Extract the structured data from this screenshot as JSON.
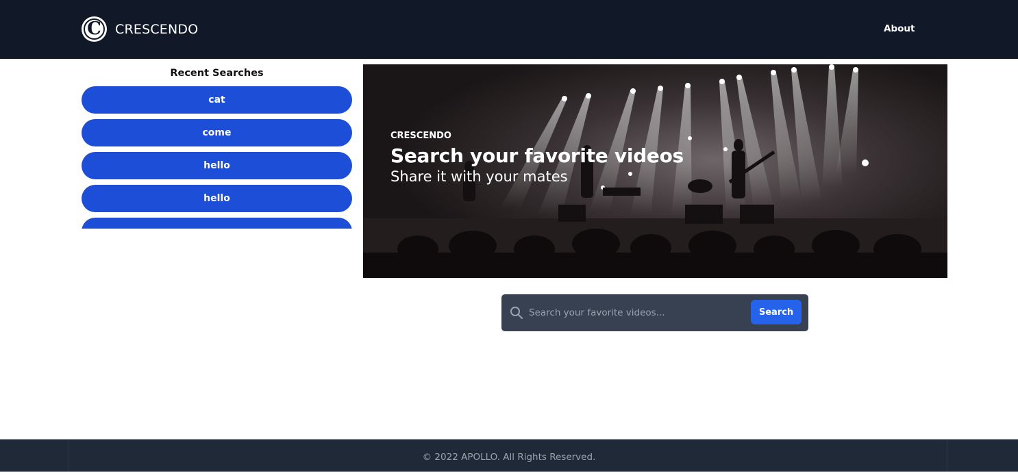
{
  "header": {
    "logo_letter": "C",
    "brand": "CRESCENDO",
    "nav": {
      "about": "About"
    }
  },
  "sidebar": {
    "title": "Recent Searches",
    "items": [
      {
        "label": "cat"
      },
      {
        "label": "come"
      },
      {
        "label": "hello"
      },
      {
        "label": "hello"
      },
      {
        "label": ""
      }
    ]
  },
  "hero": {
    "eyebrow": "CRESCENDO",
    "title": "Search your favorite videos",
    "subtitle": "Share it with your mates"
  },
  "search": {
    "placeholder": "Search your favorite videos...",
    "value": "",
    "button_label": "Search"
  },
  "footer": {
    "copyright": "© 2022 APOLLO. All Rights Reserved."
  },
  "colors": {
    "header_bg": "#111827",
    "accent_blue": "#1d4ed8",
    "button_blue": "#2563eb",
    "search_bg": "#374151",
    "footer_bg": "#1f2937"
  },
  "icons": {
    "logo": "circle-c-logo-icon",
    "search": "search-icon"
  }
}
